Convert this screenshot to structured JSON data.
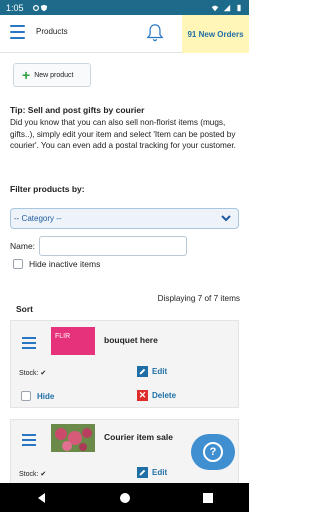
{
  "status": {
    "time": "1:05",
    "icons": [
      "settings-icon",
      "shield-icon",
      "wifi-icon",
      "signal-icon",
      "battery-icon"
    ]
  },
  "appbar": {
    "title": "Products",
    "orders_badge": "91 New Orders",
    "menu_icon": "hamburger-icon",
    "bell_icon": "bell-icon"
  },
  "actions": {
    "new_product": "New product"
  },
  "tip": {
    "title": "Tip: Sell and post gifts by courier",
    "text": "Did you know that you can also sell non-florist items (mugs, gifts..), simply edit your item and select 'Item can be posted by courier'. You can even add a postal tracking for your customer."
  },
  "filter": {
    "title": "Filter products by:",
    "category_selected": "-- Category --",
    "name_label": "Name:",
    "name_value": "",
    "hide_inactive": "Hide inactive items"
  },
  "list": {
    "displaying": "Displaying 7 of 7 items",
    "sort_label": "Sort",
    "items": [
      {
        "title": "bouquet here",
        "thumb_text": "FLIR",
        "stock": "Stock: ✔",
        "edit": "Edit",
        "hide": "Hide",
        "delete": "Delete"
      },
      {
        "title": "Courier item sale",
        "stock": "Stock: ✔",
        "edit": "Edit"
      }
    ]
  },
  "colors": {
    "accent": "#2877c5",
    "status_bar": "#1d6a8a",
    "badge_bg": "#fff6b8",
    "fab": "#3f8fd1",
    "delete": "#e02b2b"
  }
}
